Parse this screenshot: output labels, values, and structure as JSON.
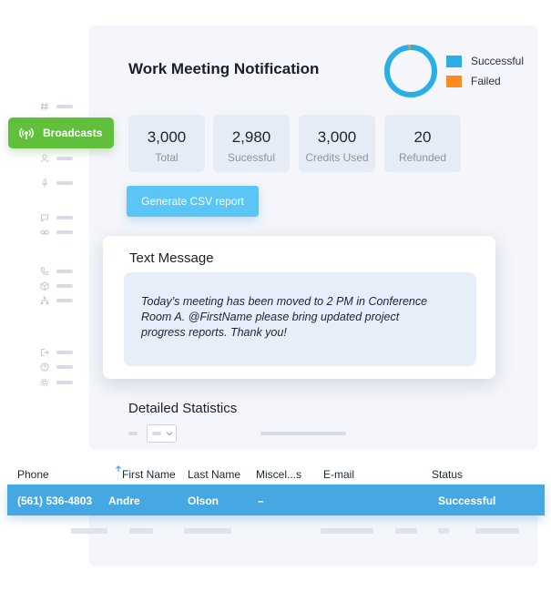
{
  "title": "Work Meeting Notification",
  "donut": {
    "successful_fraction": 0.985,
    "colors": {
      "successful": "#29aee6",
      "failed": "#ff8a1e"
    }
  },
  "legend": [
    {
      "label": "Successful",
      "color": "#29aee6"
    },
    {
      "label": "Failed",
      "color": "#ff8a1e"
    }
  ],
  "sidebar": {
    "active": {
      "label": "Broadcasts",
      "icon": "broadcast-icon",
      "color": "#61c03b"
    },
    "icons": [
      "hashtag-icon",
      "users-icon",
      "microphone-icon",
      "chat-icon",
      "voicemail-icon",
      "phone-icon",
      "box-icon",
      "sitemap-icon",
      "logout-icon",
      "help-icon",
      "gear-icon"
    ]
  },
  "stats": [
    {
      "value": "3,000",
      "label": "Total"
    },
    {
      "value": "2,980",
      "label": "Sucessful"
    },
    {
      "value": "3,000",
      "label": "Credits Used"
    },
    {
      "value": "20",
      "label": "Refunded"
    }
  ],
  "csv_button": "Generate CSV report",
  "message": {
    "title": "Text Message",
    "line1": "Today’s meeting has been moved to 2 PM in Conference",
    "line2": "Room A. @FirstName please bring updated project",
    "line3": "progress reports. Thank you!"
  },
  "detailed": {
    "title": "Detailed Statistics"
  },
  "table": {
    "columns": [
      "Phone",
      "First Name",
      "Last Name",
      "Miscel...s",
      "E-mail",
      "Status"
    ],
    "sort_icon": "sort-up-icon",
    "row": {
      "phone": "(561) 536-4803",
      "first_name": "Andre",
      "last_name": "Olson",
      "misc": "–",
      "email": "",
      "status": "Successful"
    },
    "row_color": "#45a8e2"
  }
}
